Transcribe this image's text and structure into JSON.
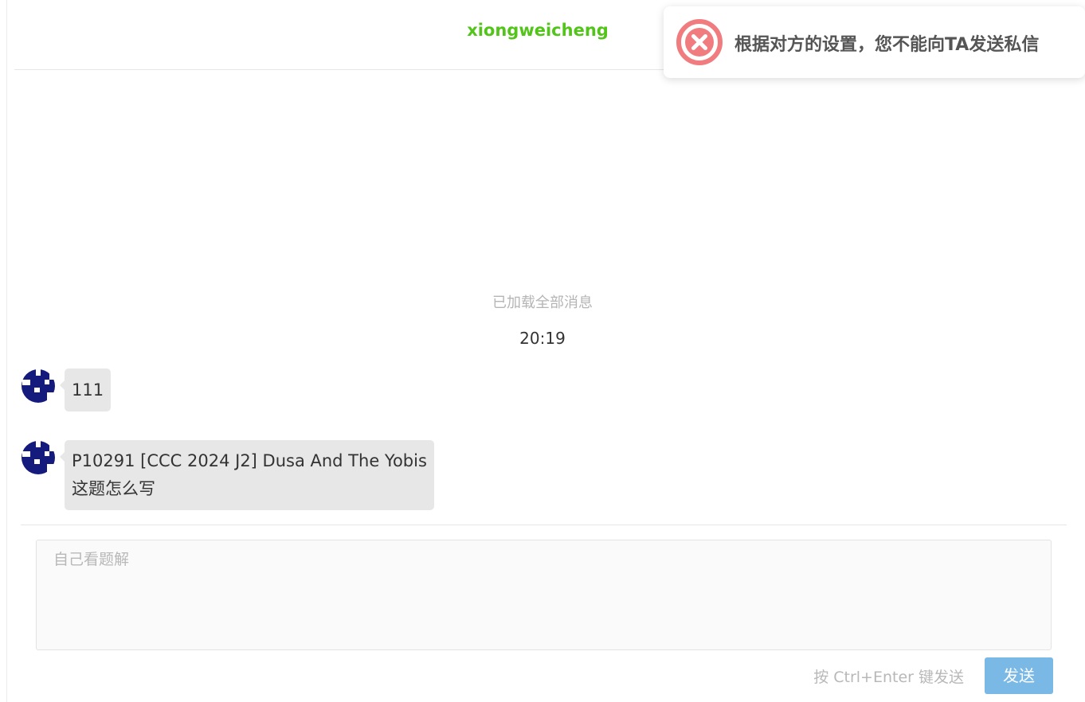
{
  "header": {
    "title": "xiongweicheng"
  },
  "conversation": {
    "loaded_note": "已加载全部消息",
    "time": "20:19",
    "messages": [
      {
        "lines": [
          "111"
        ]
      },
      {
        "lines": [
          "P10291 [CCC 2024 J2] Dusa And The Yobis",
          "这题怎么写"
        ]
      }
    ]
  },
  "composer": {
    "placeholder": "自己看题解",
    "value": "",
    "hint": "按 Ctrl+Enter 键发送",
    "send_label": "发送"
  },
  "toast": {
    "message": "根据对方的设置，您不能向TA发送私信",
    "icon": "error-circle-x"
  },
  "colors": {
    "title": "#52c41a",
    "toast_icon": "#f07c7f",
    "send_button": "#7ab8e6",
    "bubble_bg": "#e7e7e7",
    "avatar": "#151a7d"
  }
}
